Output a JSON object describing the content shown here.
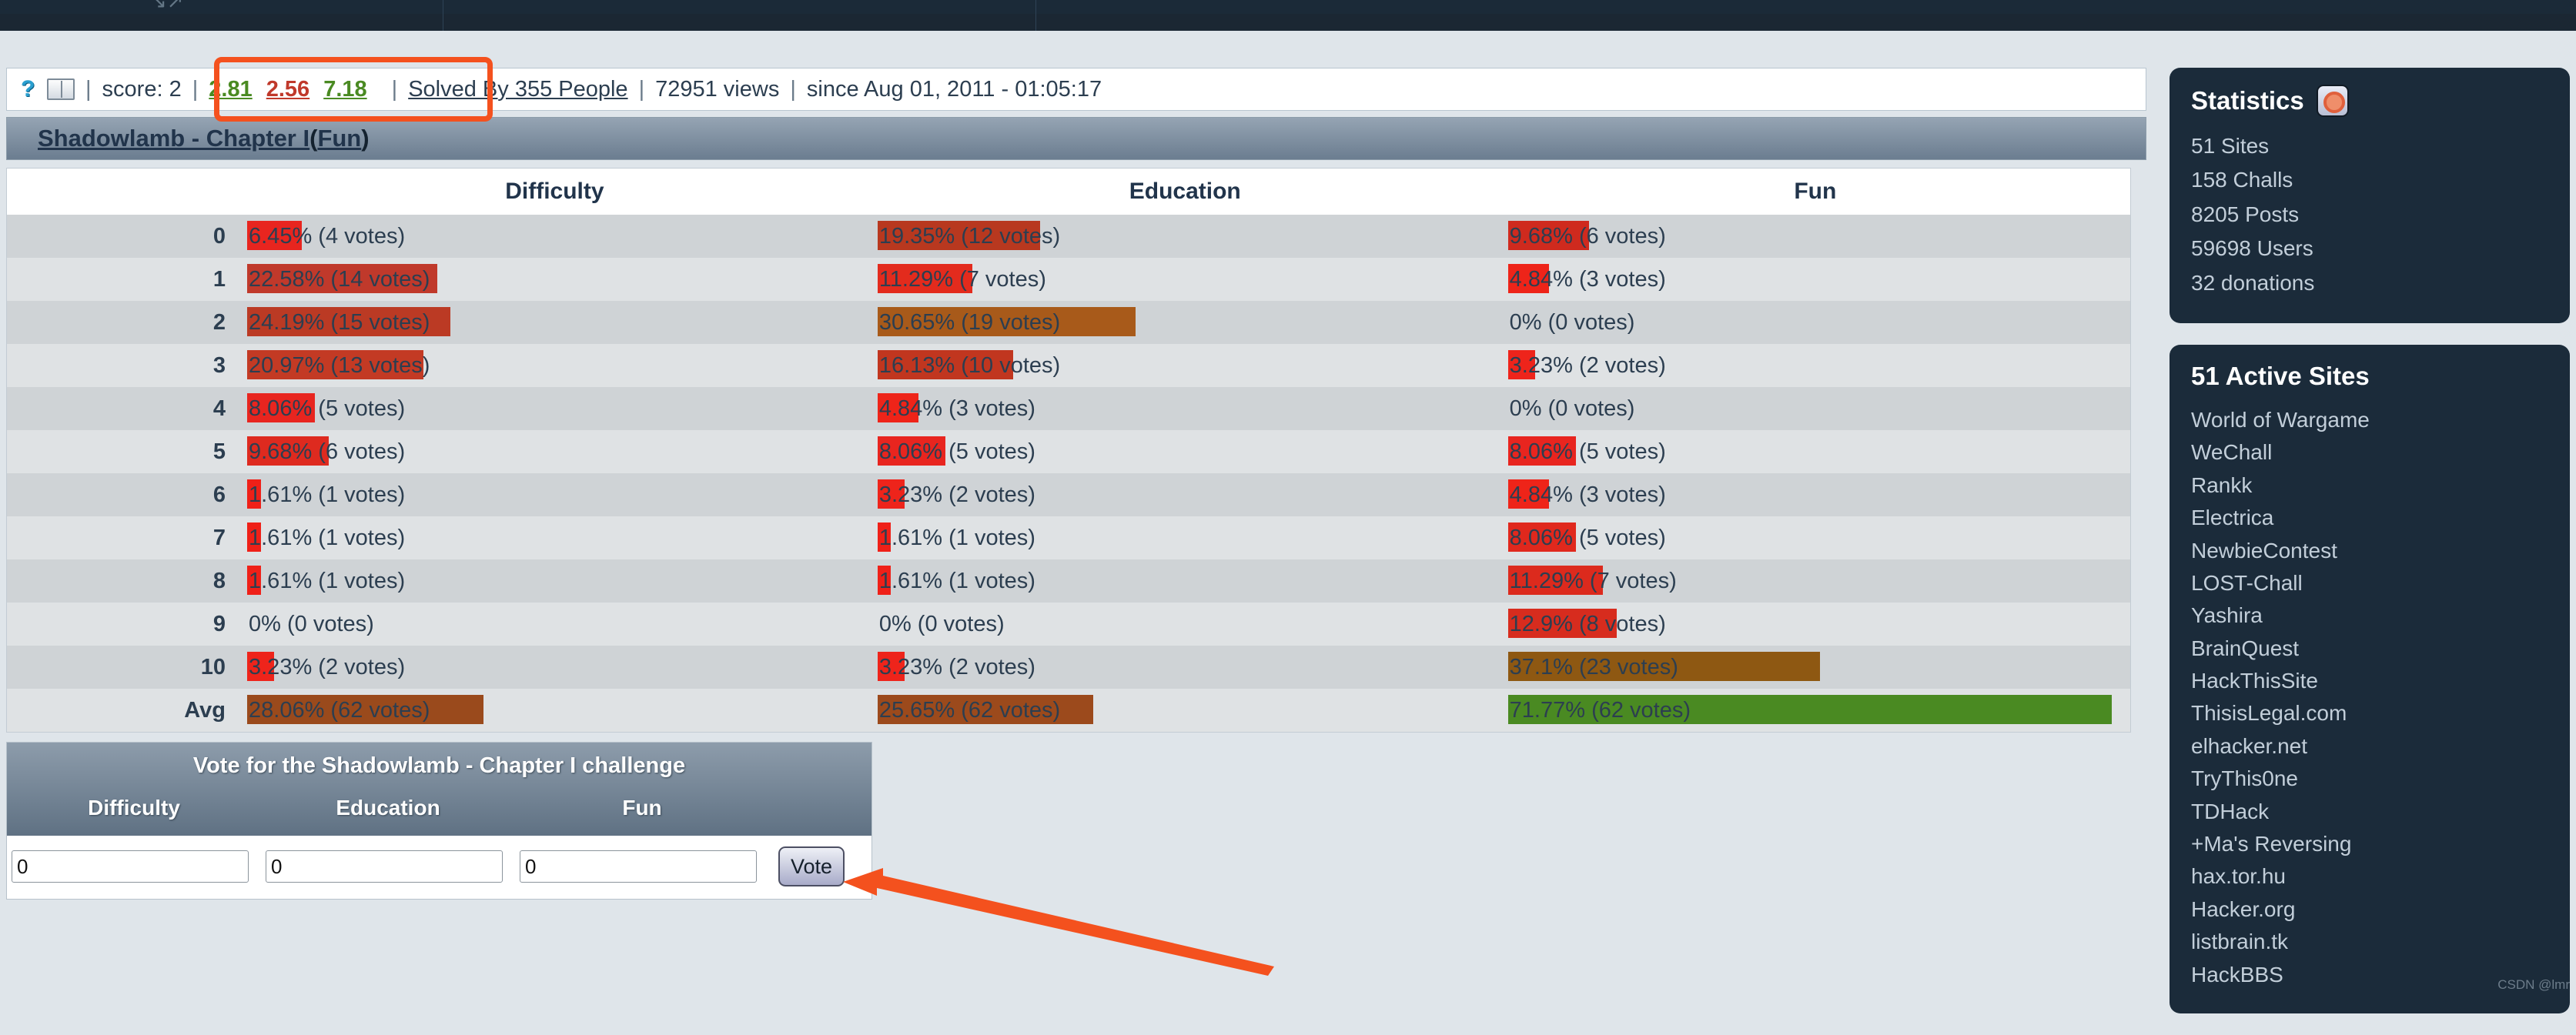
{
  "infobar": {
    "help_icon": "question-mark-icon",
    "book_icon": "book-icon",
    "score_label": "score:",
    "score_value": "2",
    "rating_difficulty": "2.81",
    "rating_education": "2.56",
    "rating_fun": "7.18",
    "solved_by": "Solved By 355 People",
    "views": "72951 views",
    "since": "since Aug 01, 2011 - 01:05:17",
    "separator": "|"
  },
  "challenge": {
    "title": "Shadowlamb - Chapter I",
    "category": "Fun",
    "open_paren": "(",
    "close_paren": ")"
  },
  "votes_table": {
    "columns": [
      "Difficulty",
      "Education",
      "Fun"
    ],
    "row_labels": [
      "0",
      "1",
      "2",
      "3",
      "4",
      "5",
      "6",
      "7",
      "8",
      "9",
      "10",
      "Avg"
    ],
    "difficulty": [
      {
        "label": "6.45% (4 votes)",
        "pct": 6.45,
        "votes": 4,
        "color": "#e8251f"
      },
      {
        "label": "22.58% (14 votes)",
        "pct": 22.58,
        "votes": 14,
        "color": "#c0392b"
      },
      {
        "label": "24.19% (15 votes)",
        "pct": 24.19,
        "votes": 15,
        "color": "#bb3a24"
      },
      {
        "label": "20.97% (13 votes)",
        "pct": 20.97,
        "votes": 13,
        "color": "#c33a24"
      },
      {
        "label": "8.06% (5 votes)",
        "pct": 8.06,
        "votes": 5,
        "color": "#e8251f"
      },
      {
        "label": "9.68% (6 votes)",
        "pct": 9.68,
        "votes": 6,
        "color": "#de2a1f"
      },
      {
        "label": "1.61% (1 votes)",
        "pct": 1.61,
        "votes": 1,
        "color": "#ef2018"
      },
      {
        "label": "1.61% (1 votes)",
        "pct": 1.61,
        "votes": 1,
        "color": "#ef2018"
      },
      {
        "label": "1.61% (1 votes)",
        "pct": 1.61,
        "votes": 1,
        "color": "#ef2018"
      },
      {
        "label": "0% (0 votes)",
        "pct": 0,
        "votes": 0,
        "color": "transparent"
      },
      {
        "label": "3.23% (2 votes)",
        "pct": 3.23,
        "votes": 2,
        "color": "#ee241b"
      },
      {
        "label": "28.06% (62 votes)",
        "pct": 28.06,
        "votes": 62,
        "color": "#9a4a1c"
      }
    ],
    "education": [
      {
        "label": "19.35% (12 votes)",
        "pct": 19.35,
        "votes": 12,
        "color": "#b8381f"
      },
      {
        "label": "11.29% (7 votes)",
        "pct": 11.29,
        "votes": 7,
        "color": "#e32b1d"
      },
      {
        "label": "30.65% (19 votes)",
        "pct": 30.65,
        "votes": 19,
        "color": "#a85a1a"
      },
      {
        "label": "16.13% (10 votes)",
        "pct": 16.13,
        "votes": 10,
        "color": "#c1361f"
      },
      {
        "label": "4.84% (3 votes)",
        "pct": 4.84,
        "votes": 3,
        "color": "#ee2419"
      },
      {
        "label": "8.06% (5 votes)",
        "pct": 8.06,
        "votes": 5,
        "color": "#e8251f"
      },
      {
        "label": "3.23% (2 votes)",
        "pct": 3.23,
        "votes": 2,
        "color": "#ee241b"
      },
      {
        "label": "1.61% (1 votes)",
        "pct": 1.61,
        "votes": 1,
        "color": "#ef2018"
      },
      {
        "label": "1.61% (1 votes)",
        "pct": 1.61,
        "votes": 1,
        "color": "#ef2018"
      },
      {
        "label": "0% (0 votes)",
        "pct": 0,
        "votes": 0,
        "color": "transparent"
      },
      {
        "label": "3.23% (2 votes)",
        "pct": 3.23,
        "votes": 2,
        "color": "#ee241b"
      },
      {
        "label": "25.65% (62 votes)",
        "pct": 25.65,
        "votes": 62,
        "color": "#9c4a1c"
      }
    ],
    "fun": [
      {
        "label": "9.68% (6 votes)",
        "pct": 9.68,
        "votes": 6,
        "color": "#cf2a1e"
      },
      {
        "label": "4.84% (3 votes)",
        "pct": 4.84,
        "votes": 3,
        "color": "#ee2419"
      },
      {
        "label": "0% (0 votes)",
        "pct": 0,
        "votes": 0,
        "color": "transparent"
      },
      {
        "label": "3.23% (2 votes)",
        "pct": 3.23,
        "votes": 2,
        "color": "#ee241b"
      },
      {
        "label": "0% (0 votes)",
        "pct": 0,
        "votes": 0,
        "color": "transparent"
      },
      {
        "label": "8.06% (5 votes)",
        "pct": 8.06,
        "votes": 5,
        "color": "#e8251f"
      },
      {
        "label": "4.84% (3 votes)",
        "pct": 4.84,
        "votes": 3,
        "color": "#ee2419"
      },
      {
        "label": "8.06% (5 votes)",
        "pct": 8.06,
        "votes": 5,
        "color": "#e0281d"
      },
      {
        "label": "11.29% (7 votes)",
        "pct": 11.29,
        "votes": 7,
        "color": "#dc2a1d"
      },
      {
        "label": "12.9% (8 votes)",
        "pct": 12.9,
        "votes": 8,
        "color": "#d72c1e"
      },
      {
        "label": "37.1% (23 votes)",
        "pct": 37.1,
        "votes": 23,
        "color": "#8e5812"
      },
      {
        "label": "71.77% (62 votes)",
        "pct": 71.77,
        "votes": 62,
        "color": "#4a8a22"
      }
    ]
  },
  "vote_form": {
    "title": "Vote for the Shadowlamb - Chapter I challenge",
    "labels": [
      "Difficulty",
      "Education",
      "Fun"
    ],
    "values": [
      "0",
      "0",
      "0"
    ],
    "button": "Vote"
  },
  "sidebar": {
    "statistics": {
      "heading": "Statistics",
      "icon": "no-entry-badge-icon",
      "lines": [
        "51 Sites",
        "158 Challs",
        "8205 Posts",
        "59698 Users",
        "32 donations"
      ]
    },
    "active_sites": {
      "heading": "51 Active Sites",
      "sites": [
        "World of Wargame",
        "WeChall",
        "Rankk",
        "Electrica",
        "NewbieContest",
        "LOST-Chall",
        "Yashira",
        "BrainQuest",
        "HackThisSite",
        "ThisisLegal.com",
        "elhacker.net",
        "TryThis0ne",
        "TDHack",
        "+Ma's Reversing",
        "hax.tor.hu",
        "Hacker.org",
        "listbrain.tk",
        "HackBBS"
      ]
    }
  },
  "watermark": "CSDN @lmr",
  "colors": {
    "accent_annotation": "#f4511e",
    "link": "#21344b",
    "rating_good": "#4a8a22",
    "rating_bad": "#c0392b"
  }
}
